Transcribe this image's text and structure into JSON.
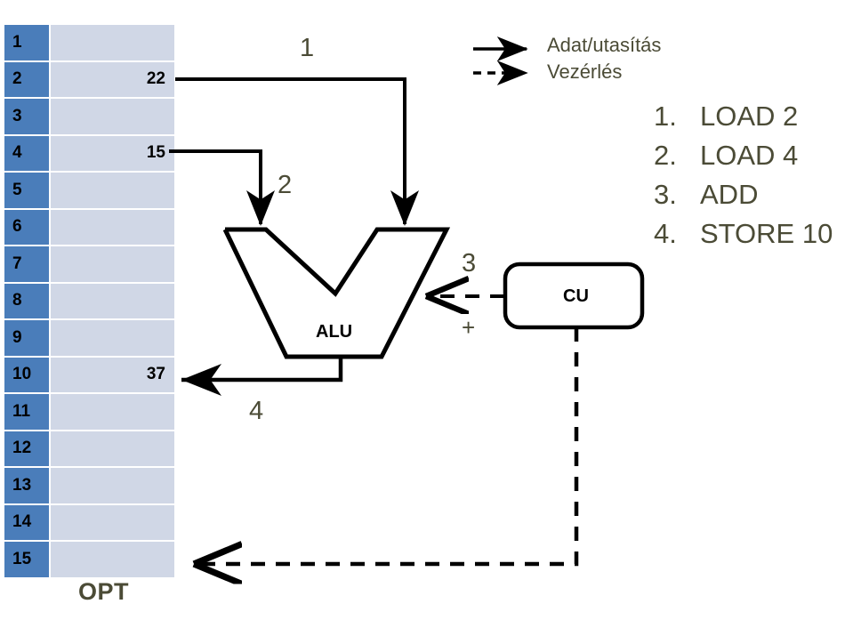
{
  "memory": {
    "name": "OPT",
    "label": "OPT",
    "rows": [
      {
        "addr": "1",
        "value": ""
      },
      {
        "addr": "2",
        "value": "22"
      },
      {
        "addr": "3",
        "value": ""
      },
      {
        "addr": "4",
        "value": "15"
      },
      {
        "addr": "5",
        "value": ""
      },
      {
        "addr": "6",
        "value": ""
      },
      {
        "addr": "7",
        "value": ""
      },
      {
        "addr": "8",
        "value": ""
      },
      {
        "addr": "9",
        "value": ""
      },
      {
        "addr": "10",
        "value": "37"
      },
      {
        "addr": "11",
        "value": ""
      },
      {
        "addr": "12",
        "value": ""
      },
      {
        "addr": "13",
        "value": ""
      },
      {
        "addr": "14",
        "value": ""
      },
      {
        "addr": "15",
        "value": ""
      }
    ],
    "header_color": "#4a7dba",
    "cell_color": "#d0d7e6"
  },
  "units": {
    "alu_label": "ALU",
    "cu_label": "CU",
    "operation_symbol": "+"
  },
  "steps": {
    "one": "1",
    "two": "2",
    "three": "3",
    "four": "4"
  },
  "legend": {
    "items": [
      {
        "label": "Adat/utasítás",
        "style": "solid",
        "icon": "arrow-right-solid-icon"
      },
      {
        "label": "Vezérlés",
        "style": "dashed",
        "icon": "arrow-right-dashed-icon"
      }
    ]
  },
  "program": {
    "instructions": [
      {
        "num": "1.",
        "text": "LOAD 2"
      },
      {
        "num": "2.",
        "text": "LOAD 4"
      },
      {
        "num": "3.",
        "text": "ADD"
      },
      {
        "num": "4.",
        "text": "STORE 10"
      }
    ]
  },
  "colors": {
    "label_text": "#4b4b36",
    "line": "#000000",
    "memory_header": "#4a7dba",
    "memory_cell": "#d0d7e6"
  }
}
